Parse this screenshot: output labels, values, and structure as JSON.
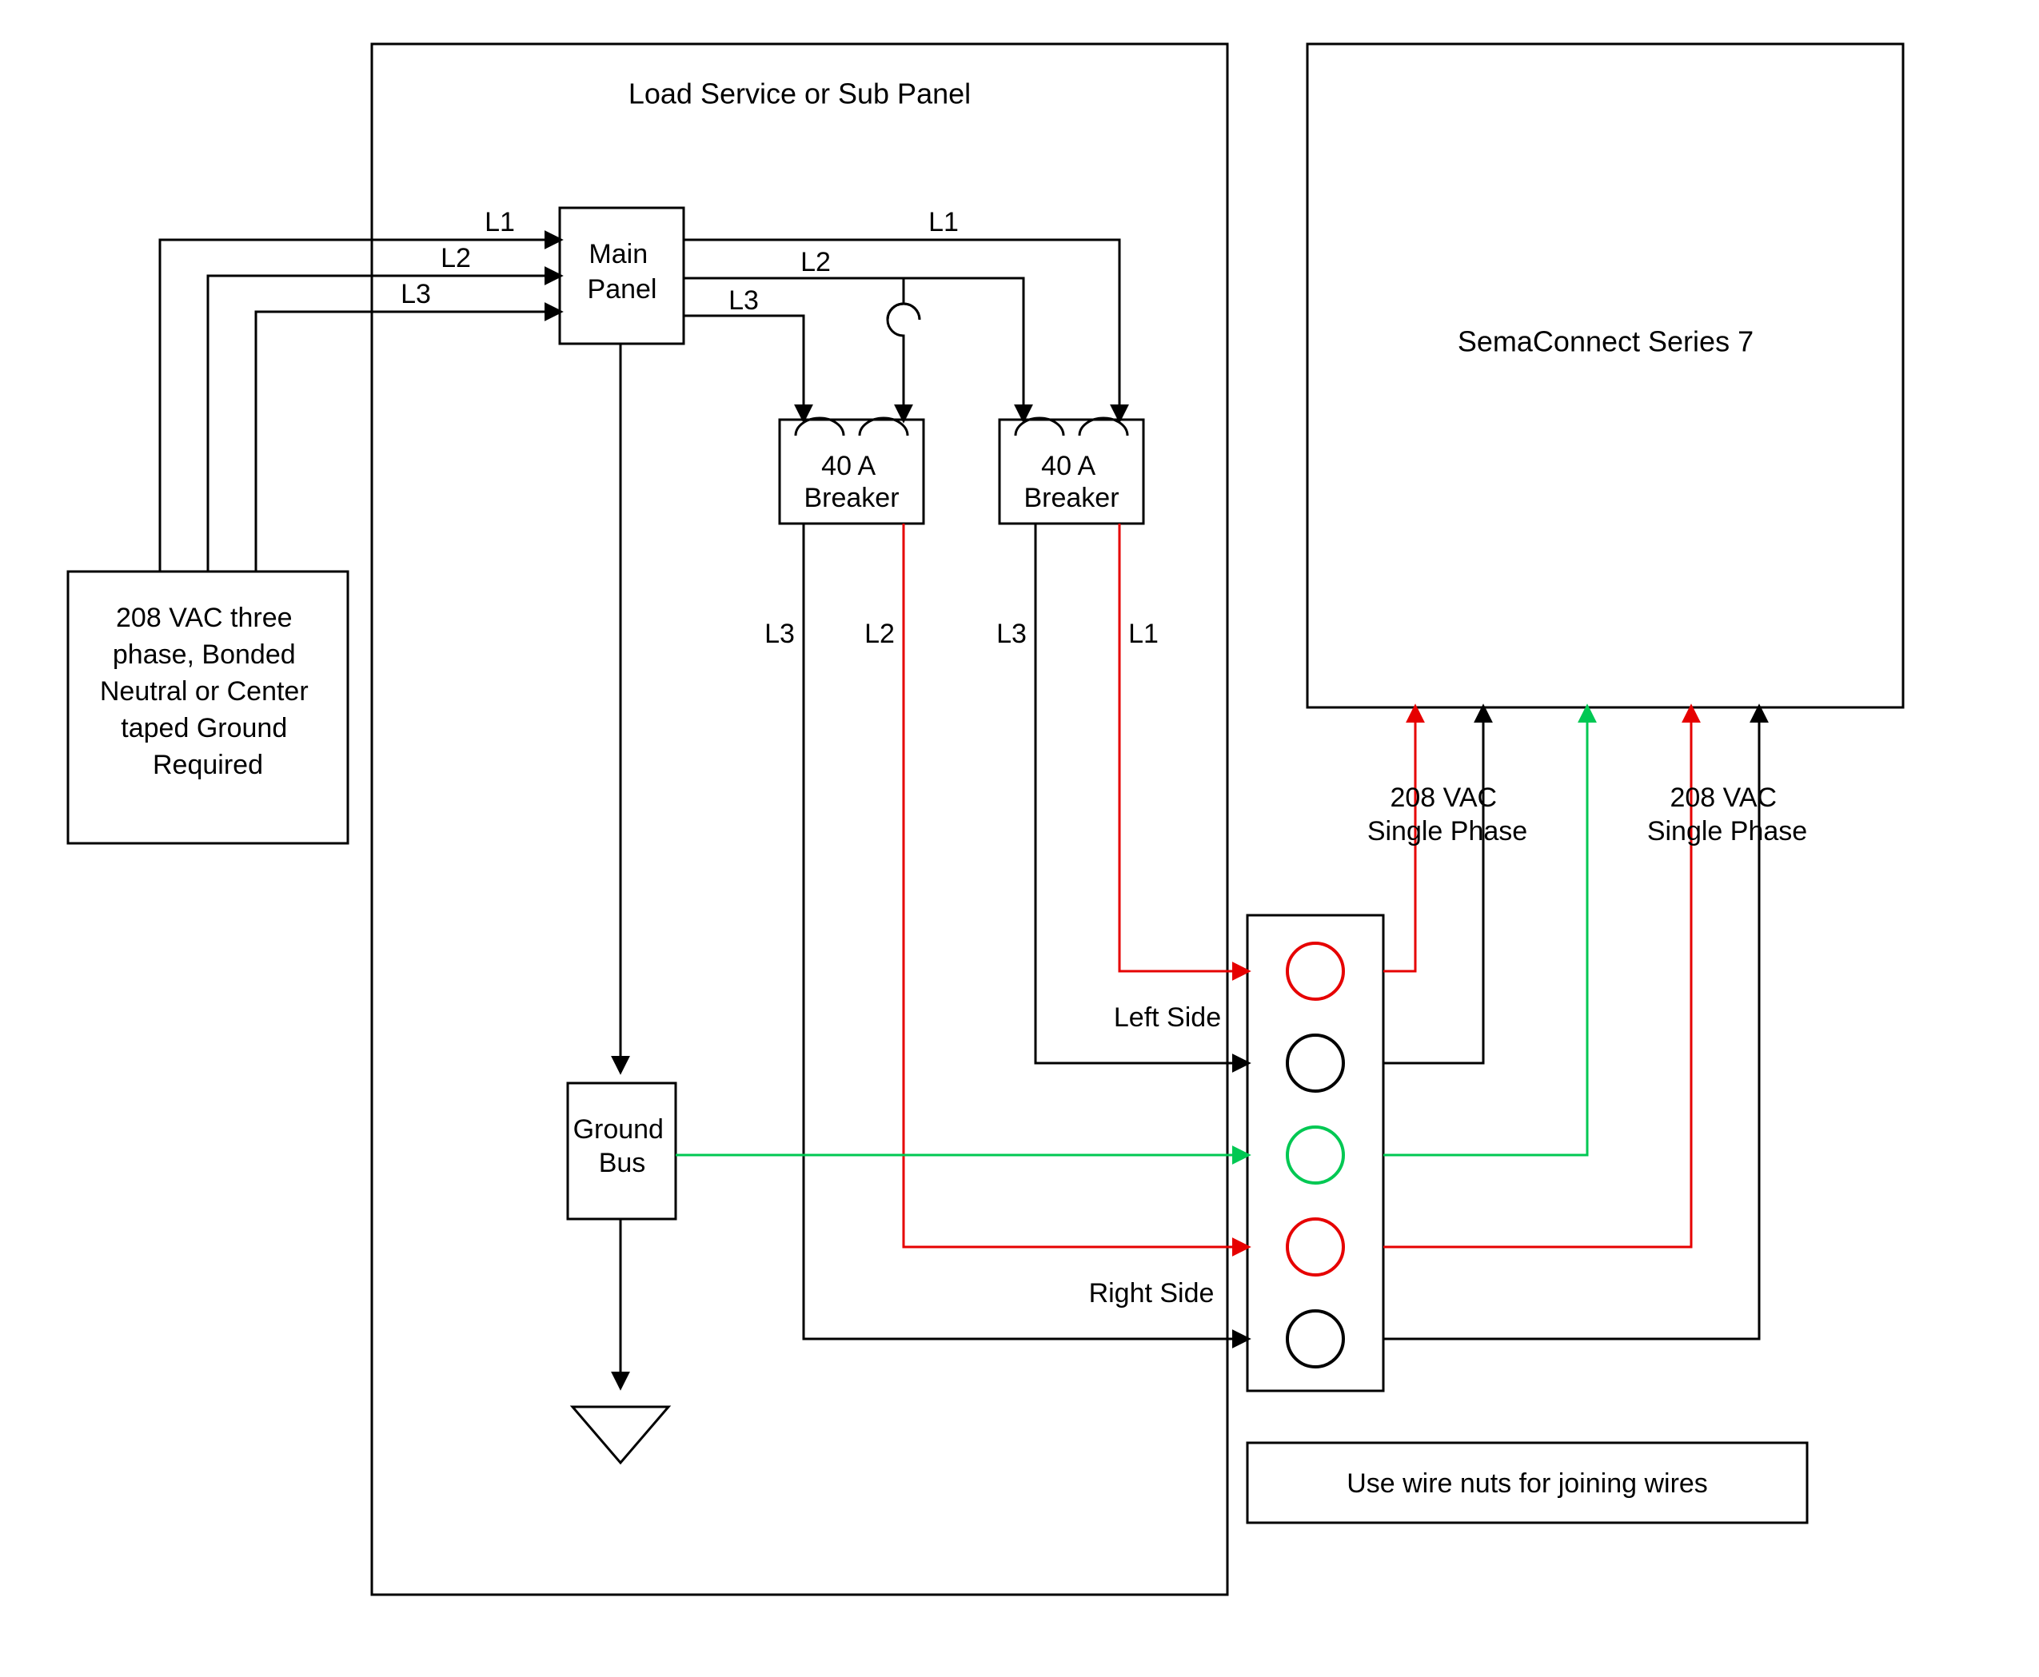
{
  "diagram": {
    "title": "Load Service or Sub Panel",
    "source_box": "208 VAC three phase, Bonded Neutral or Center taped Ground Required",
    "main_panel": "Main Panel",
    "breaker1": "40 A Breaker",
    "breaker2": "40 A Breaker",
    "ground_bus": "Ground Bus",
    "device_box": "SemaConnect Series 7",
    "note_box": "Use wire nuts for joining wires",
    "phase1_label": "208 VAC Single Phase",
    "phase2_label": "208 VAC Single Phase",
    "left_side": "Left Side",
    "right_side": "Right Side",
    "lines": {
      "L1": "L1",
      "L2": "L2",
      "L3": "L3"
    },
    "colors": {
      "black": "#000000",
      "red": "#e60000",
      "green": "#00c853"
    }
  }
}
